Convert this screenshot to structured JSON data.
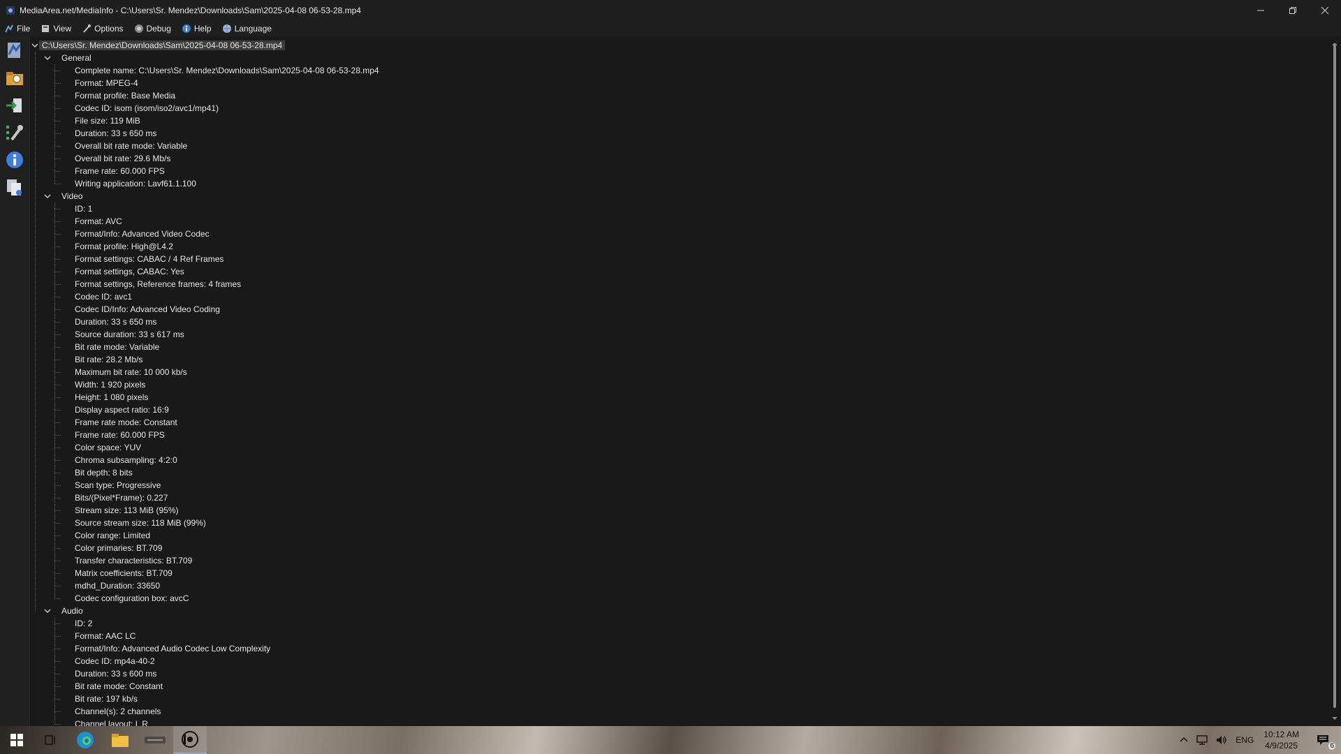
{
  "window": {
    "title": "MediaArea.net/MediaInfo - C:\\Users\\Sr. Mendez\\Downloads\\Sam\\2025-04-08 06-53-28.mp4"
  },
  "menu": [
    {
      "label": "File",
      "icon": "file-icon"
    },
    {
      "label": "View",
      "icon": "view-icon"
    },
    {
      "label": "Options",
      "icon": "options-icon"
    },
    {
      "label": "Debug",
      "icon": "debug-icon"
    },
    {
      "label": "Help",
      "icon": "help-icon"
    },
    {
      "label": "Language",
      "icon": "language-icon"
    }
  ],
  "tree": {
    "root": "C:\\Users\\Sr. Mendez\\Downloads\\Sam\\2025-04-08 06-53-28.mp4",
    "sections": [
      {
        "name": "General",
        "items": [
          "Complete name: C:\\Users\\Sr. Mendez\\Downloads\\Sam\\2025-04-08 06-53-28.mp4",
          "Format: MPEG-4",
          "Format profile: Base Media",
          "Codec ID: isom (isom/iso2/avc1/mp41)",
          "File size: 119 MiB",
          "Duration: 33 s 650 ms",
          "Overall bit rate mode: Variable",
          "Overall bit rate: 29.6 Mb/s",
          "Frame rate: 60.000 FPS",
          "Writing application: Lavf61.1.100"
        ]
      },
      {
        "name": "Video",
        "items": [
          "ID: 1",
          "Format: AVC",
          "Format/Info: Advanced Video Codec",
          "Format profile: High@L4.2",
          "Format settings: CABAC / 4 Ref Frames",
          "Format settings, CABAC: Yes",
          "Format settings, Reference frames: 4 frames",
          "Codec ID: avc1",
          "Codec ID/Info: Advanced Video Coding",
          "Duration: 33 s 650 ms",
          "Source duration: 33 s 617 ms",
          "Bit rate mode: Variable",
          "Bit rate: 28.2 Mb/s",
          "Maximum bit rate: 10 000 kb/s",
          "Width: 1 920 pixels",
          "Height: 1 080 pixels",
          "Display aspect ratio: 16:9",
          "Frame rate mode: Constant",
          "Frame rate: 60.000 FPS",
          "Color space: YUV",
          "Chroma subsampling: 4:2:0",
          "Bit depth: 8 bits",
          "Scan type: Progressive",
          "Bits/(Pixel*Frame): 0.227",
          "Stream size: 113 MiB (95%)",
          "Source stream size: 118 MiB (99%)",
          "Color range: Limited",
          "Color primaries: BT.709",
          "Transfer characteristics: BT.709",
          "Matrix coefficients: BT.709",
          "mdhd_Duration: 33650",
          "Codec configuration box: avcC"
        ]
      },
      {
        "name": "Audio",
        "items": [
          "ID: 2",
          "Format: AAC LC",
          "Format/Info: Advanced Audio Codec Low Complexity",
          "Codec ID: mp4a-40-2",
          "Duration: 33 s 600 ms",
          "Bit rate mode: Constant",
          "Bit rate: 197 kb/s",
          "Channel(s): 2 channels",
          "Channel layout: L R"
        ]
      }
    ]
  },
  "taskbar": {
    "language": "ENG",
    "time": "10:12 AM",
    "date": "4/9/2025",
    "notification_count": "6"
  },
  "colors": {
    "background": "#191919",
    "text": "#e6e6e6",
    "selection": "#3d3d3d"
  }
}
